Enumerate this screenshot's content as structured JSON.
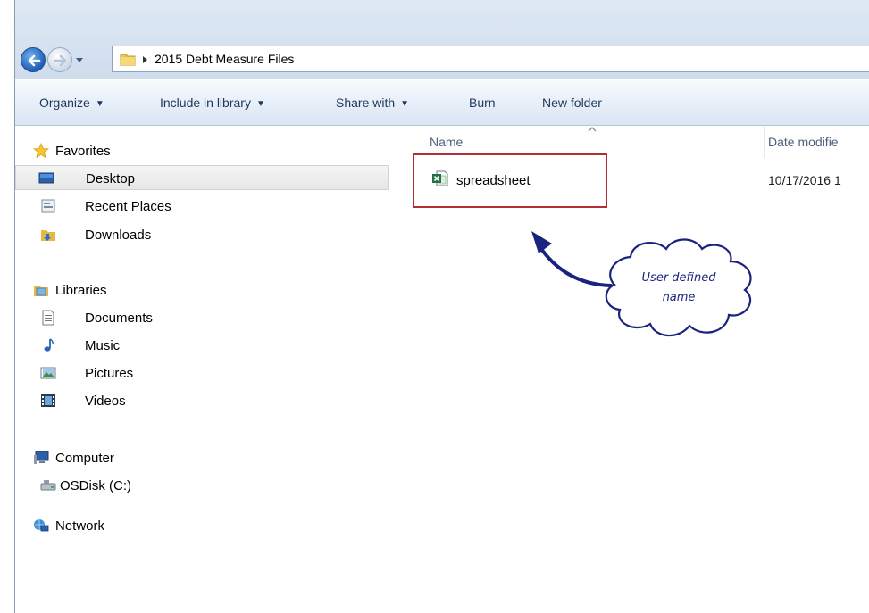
{
  "address": {
    "breadcrumb": "2015 Debt Measure Files"
  },
  "toolbar": {
    "organize": "Organize",
    "include_in_library": "Include in library",
    "share_with": "Share with",
    "burn": "Burn",
    "new_folder": "New folder"
  },
  "navpane": {
    "favorites": "Favorites",
    "desktop": "Desktop",
    "recent_places": "Recent Places",
    "downloads": "Downloads",
    "libraries": "Libraries",
    "documents": "Documents",
    "music": "Music",
    "pictures": "Pictures",
    "videos": "Videos",
    "computer": "Computer",
    "osdisk": "OSDisk (C:)",
    "network": "Network"
  },
  "content": {
    "col_name": "Name",
    "col_date": "Date modifie",
    "file": {
      "name": "spreadsheet",
      "date": "10/17/2016 1"
    }
  },
  "annotation": {
    "line1": "User defined",
    "line2": "name",
    "box_color": "#b32d34",
    "arrow_color": "#1a237e"
  }
}
